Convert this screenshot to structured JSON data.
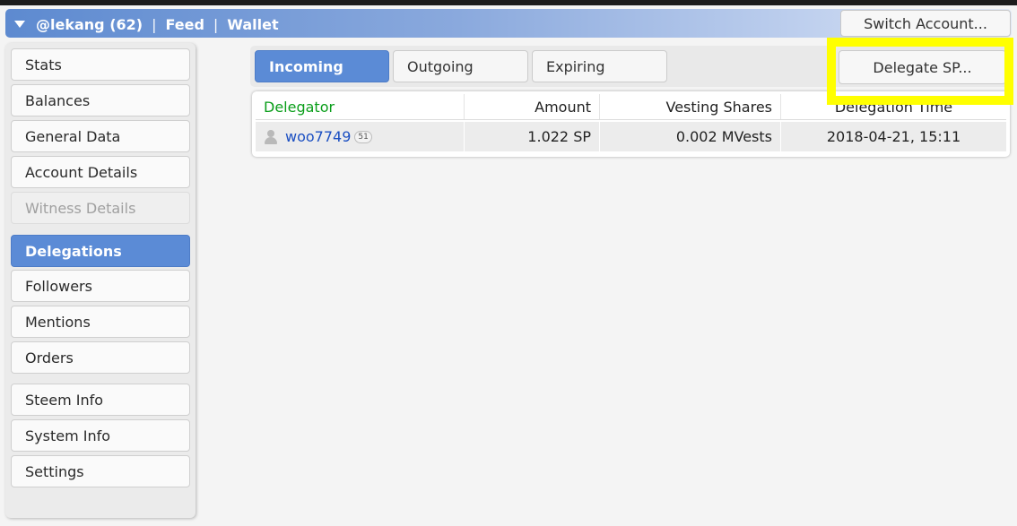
{
  "header": {
    "account": "@lekang (62)",
    "separator": "|",
    "feed": "Feed",
    "wallet": "Wallet",
    "switch_account": "Switch Account..."
  },
  "sidebar": {
    "items": [
      {
        "label": "Stats"
      },
      {
        "label": "Balances"
      },
      {
        "label": "General Data"
      },
      {
        "label": "Account Details"
      },
      {
        "label": "Witness Details",
        "disabled": true
      },
      {
        "label": "Delegations",
        "active": true
      },
      {
        "label": "Followers"
      },
      {
        "label": "Mentions"
      },
      {
        "label": "Orders"
      },
      {
        "label": "Steem Info"
      },
      {
        "label": "System Info"
      },
      {
        "label": "Settings"
      }
    ]
  },
  "tabs": [
    {
      "label": "Incoming",
      "active": true
    },
    {
      "label": "Outgoing"
    },
    {
      "label": "Expiring"
    }
  ],
  "delegate_button": "Delegate SP...",
  "table": {
    "columns": [
      "Delegator",
      "Amount",
      "Vesting Shares",
      "Delegation Time"
    ],
    "rows": [
      {
        "delegator": "woo7749",
        "reputation": "51",
        "amount": "1.022 SP",
        "vesting_shares": "0.002 MVests",
        "time": "2018-04-21, 15:11"
      }
    ]
  },
  "colors": {
    "accent": "#5b8bd6",
    "header_green": "#0a9e1a",
    "link": "#1b4fc2",
    "highlight": "#ffff00"
  }
}
